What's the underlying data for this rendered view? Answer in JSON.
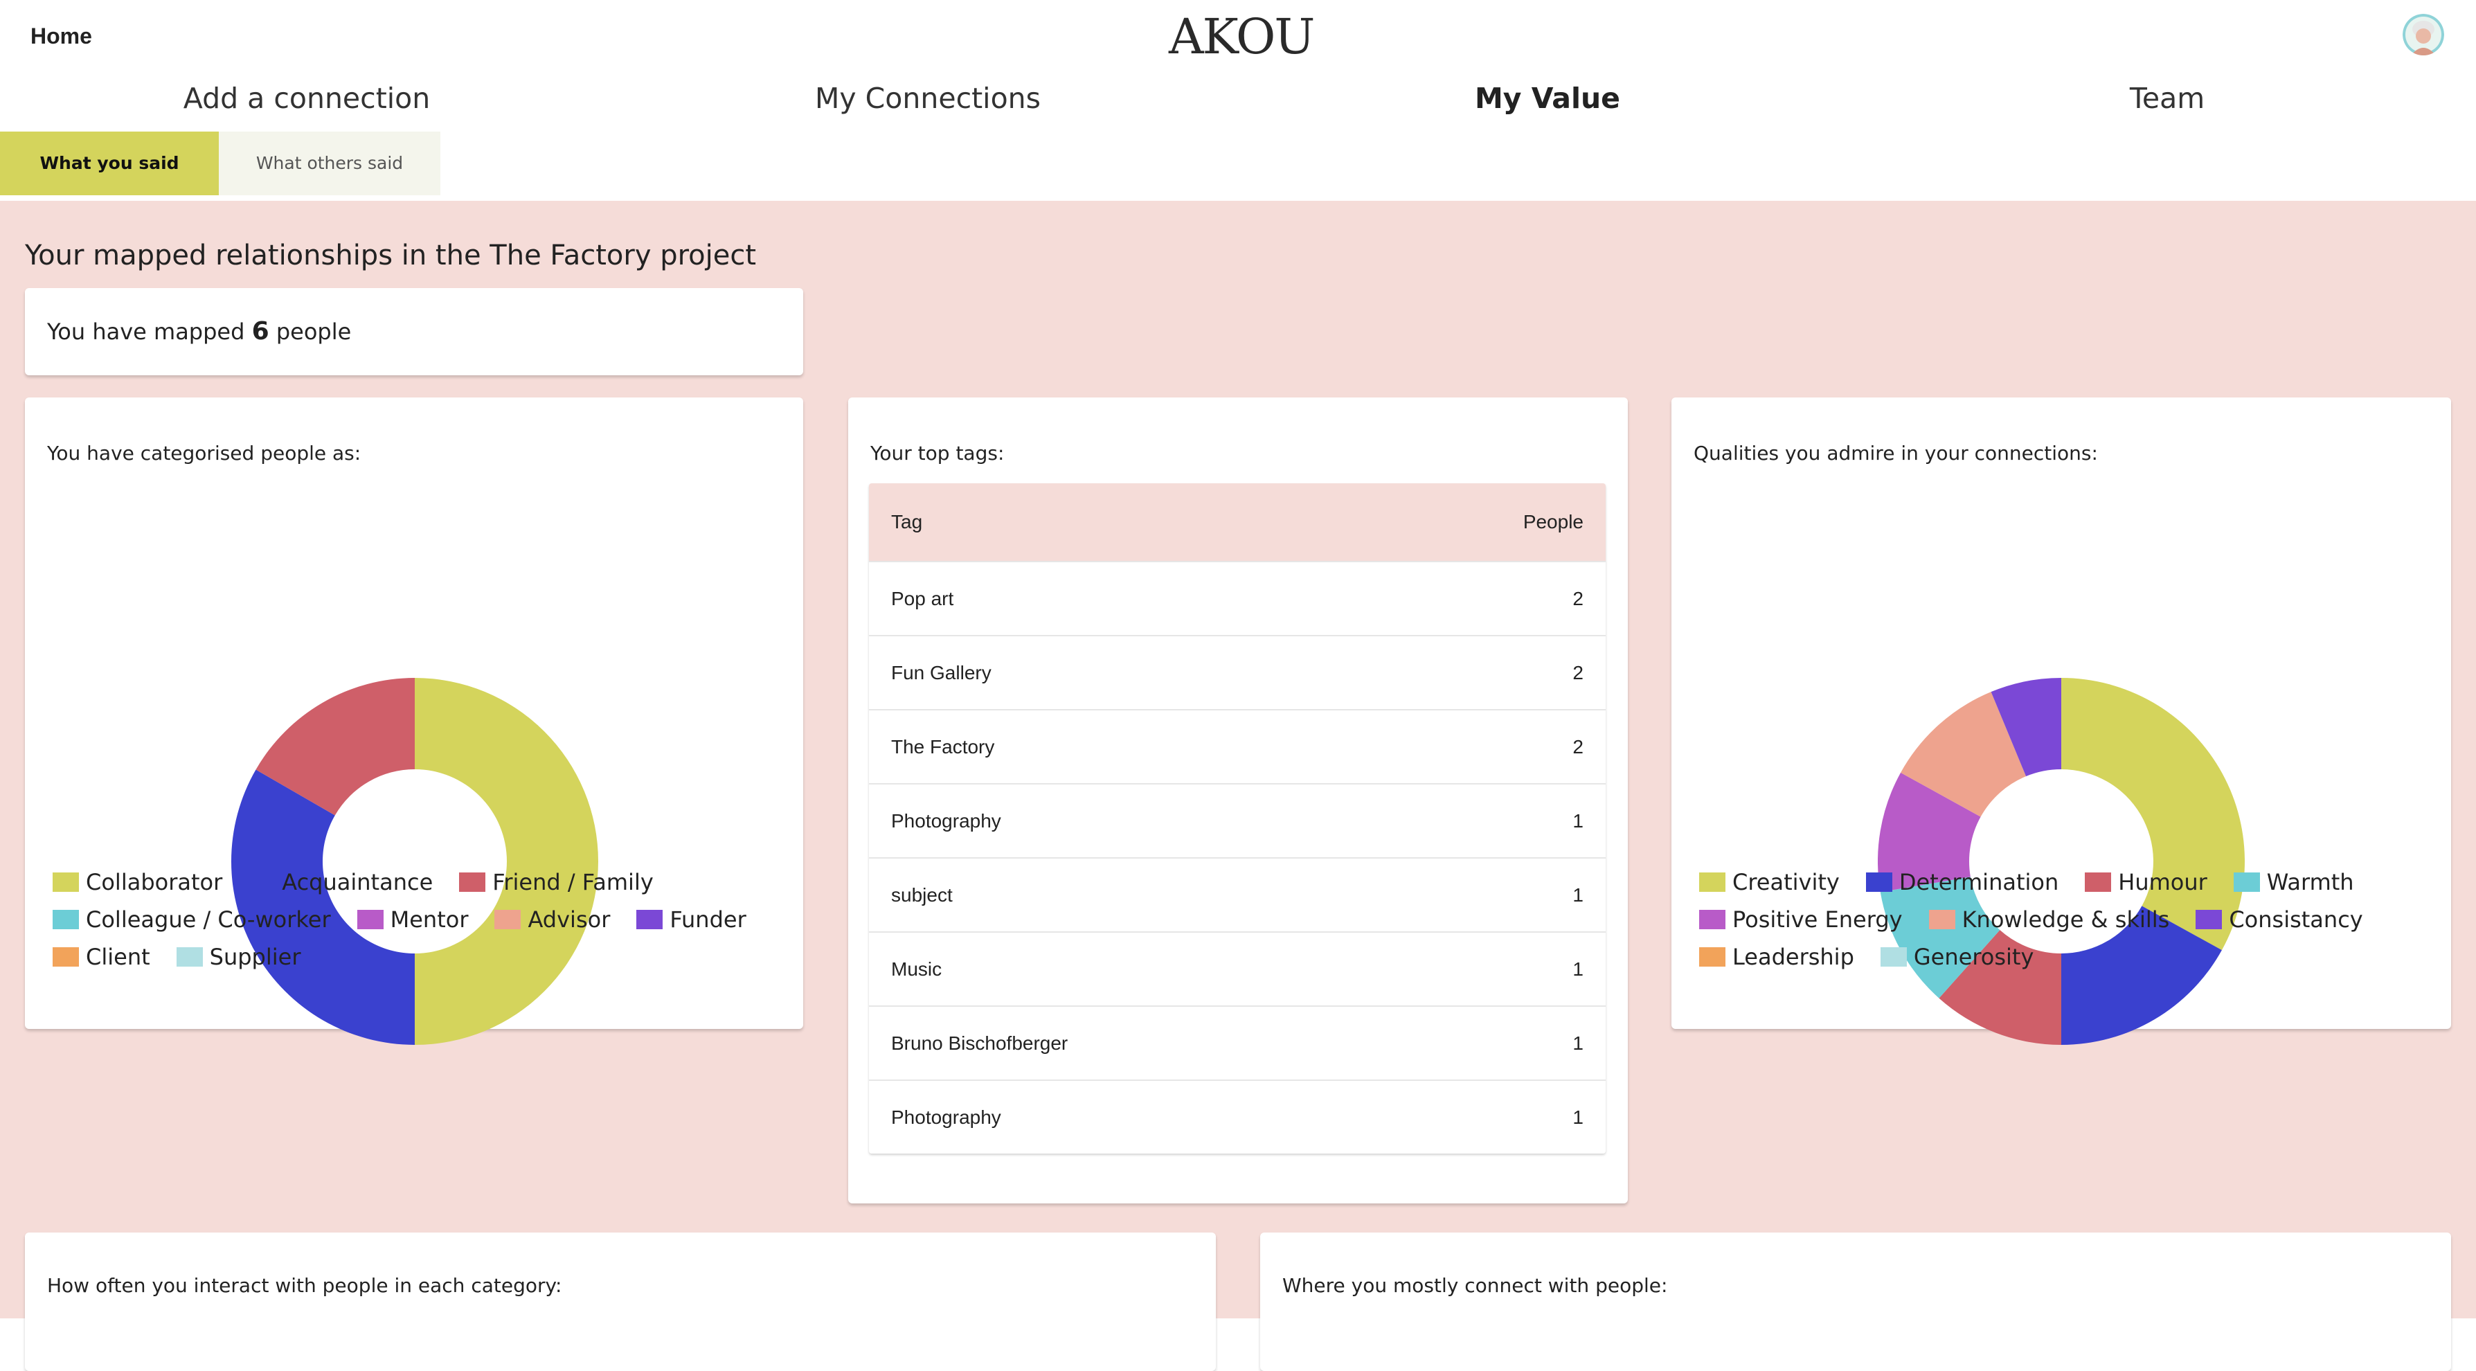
{
  "header": {
    "home_label": "Home",
    "logo_text": "AKOU"
  },
  "nav": {
    "tabs": [
      {
        "label": "Add a connection"
      },
      {
        "label": "My Connections"
      },
      {
        "label": "My Value",
        "active": true
      },
      {
        "label": "Team"
      }
    ]
  },
  "subtabs": [
    {
      "label": "What you said",
      "active": true
    },
    {
      "label": "What others said"
    }
  ],
  "main": {
    "title": "Your mapped relationships in the The Factory project",
    "mapped": {
      "prefix": "You have mapped",
      "count": "6",
      "suffix": "people"
    }
  },
  "categories_card": {
    "label": "You have categorised people as:",
    "chart_data": {
      "type": "pie",
      "donut": true,
      "slices": [
        {
          "name": "Collaborator",
          "value": 3,
          "color": "#d4d45c"
        },
        {
          "name": "Acquaintance",
          "value": 2,
          "color": "#3a41cf"
        },
        {
          "name": "Friend / Family",
          "value": 1,
          "color": "#cf5f69"
        }
      ],
      "legend": [
        {
          "name": "Collaborator",
          "color": "#d4d45c"
        },
        {
          "name": "Acquaintance",
          "color": "#3a41cf"
        },
        {
          "name": "Friend / Family",
          "color": "#cf5f69"
        },
        {
          "name": "Colleague / Co-worker",
          "color": "#6ccdd6"
        },
        {
          "name": "Mentor",
          "color": "#b85bc8"
        },
        {
          "name": "Advisor",
          "color": "#eea38e"
        },
        {
          "name": "Funder",
          "color": "#7b48d6"
        },
        {
          "name": "Client",
          "color": "#f2a35a"
        },
        {
          "name": "Supplier",
          "color": "#b0dfe3"
        }
      ],
      "legend_position": "bottom"
    }
  },
  "tags_card": {
    "label": "Your top tags:",
    "columns": [
      "Tag",
      "People"
    ],
    "rows": [
      {
        "tag": "Pop art",
        "people": "2"
      },
      {
        "tag": "Fun Gallery",
        "people": "2"
      },
      {
        "tag": "The Factory",
        "people": "2"
      },
      {
        "tag": "Photography",
        "people": "1"
      },
      {
        "tag": "subject",
        "people": "1"
      },
      {
        "tag": "Music",
        "people": "1"
      },
      {
        "tag": "Bruno Bischofberger",
        "people": "1"
      },
      {
        "tag": "Photography",
        "people": "1"
      }
    ]
  },
  "qualities_card": {
    "label": "Qualities you admire in your connections:",
    "chart_data": {
      "type": "pie",
      "donut": true,
      "slices": [
        {
          "name": "Creativity",
          "value": 18.5,
          "color": "#d4d45c"
        },
        {
          "name": "Determination",
          "value": 9.5,
          "color": "#3a41cf"
        },
        {
          "name": "Humour",
          "value": 6.5,
          "color": "#cf5f69"
        },
        {
          "name": "Warmth",
          "value": 6,
          "color": "#6ccdd6"
        },
        {
          "name": "Positive Energy",
          "value": 6,
          "color": "#b85bc8"
        },
        {
          "name": "Knowledge & skills",
          "value": 6,
          "color": "#eea38e"
        },
        {
          "name": "Consistancy",
          "value": 3.5,
          "color": "#7b48d6"
        }
      ],
      "legend": [
        {
          "name": "Creativity",
          "color": "#d4d45c"
        },
        {
          "name": "Determination",
          "color": "#3a41cf"
        },
        {
          "name": "Humour",
          "color": "#cf5f69"
        },
        {
          "name": "Warmth",
          "color": "#6ccdd6"
        },
        {
          "name": "Positive Energy",
          "color": "#b85bc8"
        },
        {
          "name": "Knowledge & skills",
          "color": "#eea38e"
        },
        {
          "name": "Consistancy",
          "color": "#7b48d6"
        },
        {
          "name": "Leadership",
          "color": "#f2a35a"
        },
        {
          "name": "Generosity",
          "color": "#b0dfe3"
        }
      ],
      "legend_position": "bottom"
    }
  },
  "bottom_cards": {
    "interact_label": "How often you interact with people in each category:",
    "connect_label": "Where you mostly connect with people:"
  }
}
